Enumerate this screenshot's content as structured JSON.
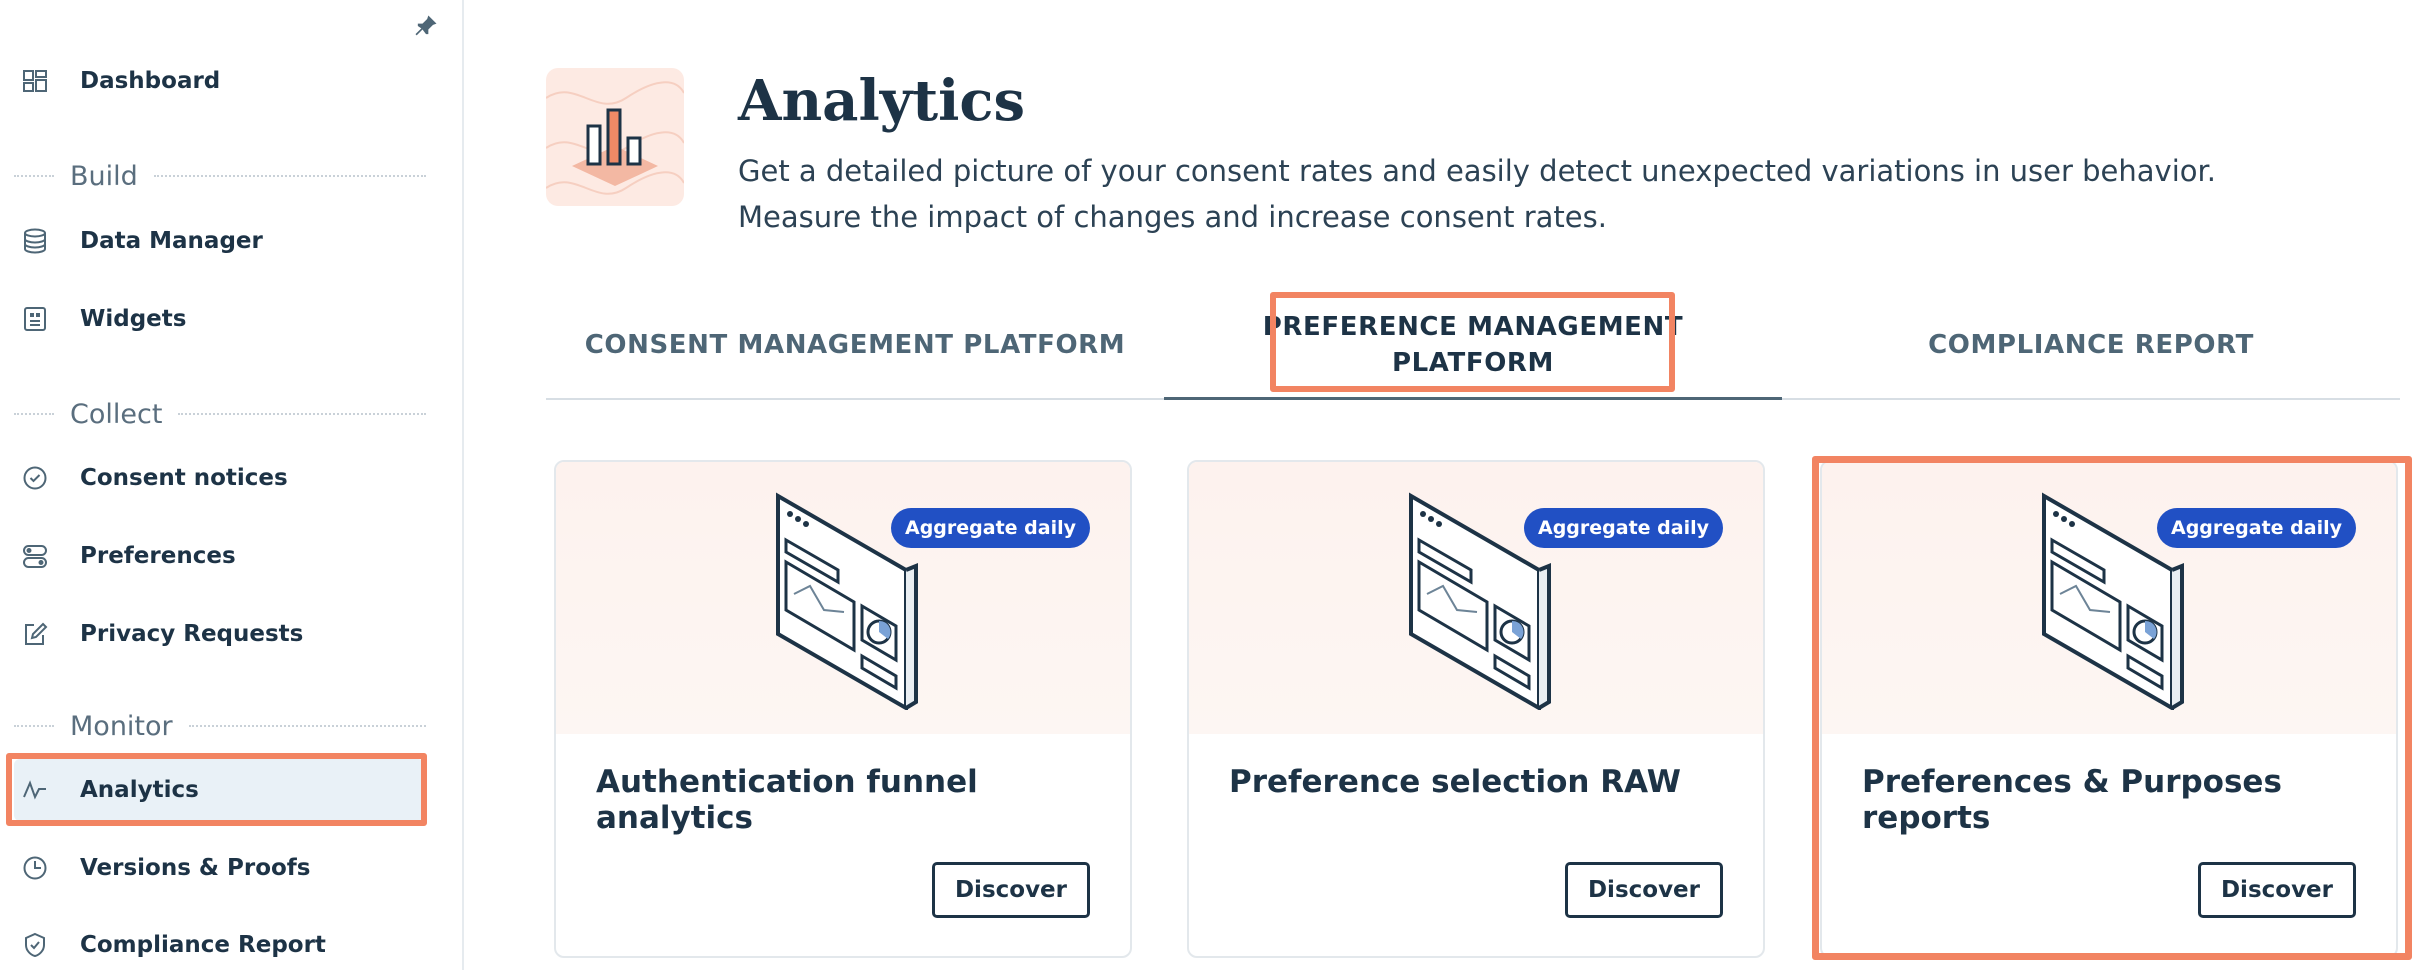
{
  "sidebar": {
    "dashboard": "Dashboard",
    "sections": [
      "Build",
      "Collect",
      "Monitor"
    ],
    "build_items": [
      "Data Manager",
      "Widgets"
    ],
    "collect_items": [
      "Consent notices",
      "Preferences",
      "Privacy Requests"
    ],
    "monitor_items": [
      "Analytics",
      "Versions & Proofs",
      "Compliance Report"
    ],
    "active_item": "Analytics"
  },
  "header": {
    "title": "Analytics",
    "description_line1": "Get a detailed picture of your consent rates and easily detect unexpected variations in user behavior.",
    "description_line2": "Measure the impact of changes and increase consent rates."
  },
  "tabs": [
    {
      "label": "CONSENT MANAGEMENT PLATFORM"
    },
    {
      "label_line1": "PREFERENCE MANAGEMENT",
      "label_line2": "PLATFORM"
    },
    {
      "label": "COMPLIANCE REPORT"
    }
  ],
  "active_tab": "PREFERENCE MANAGEMENT PLATFORM",
  "cards": [
    {
      "title": "Authentication funnel analytics",
      "badge": "Aggregate daily",
      "button": "Discover",
      "icon": "dashboard-screen-icon"
    },
    {
      "title": "Preference selection RAW",
      "badge": "Aggregate daily",
      "button": "Discover",
      "icon": "dashboard-screen-icon"
    },
    {
      "title": "Preferences & Purposes reports",
      "badge": "Aggregate daily",
      "button": "Discover",
      "icon": "dashboard-screen-icon"
    }
  ],
  "colors": {
    "text": "#1d3346",
    "accent_badge": "#2150c4",
    "highlight": "#f28462",
    "active_bg": "#e9f1f7",
    "hero_bg": "#fdeae3"
  }
}
